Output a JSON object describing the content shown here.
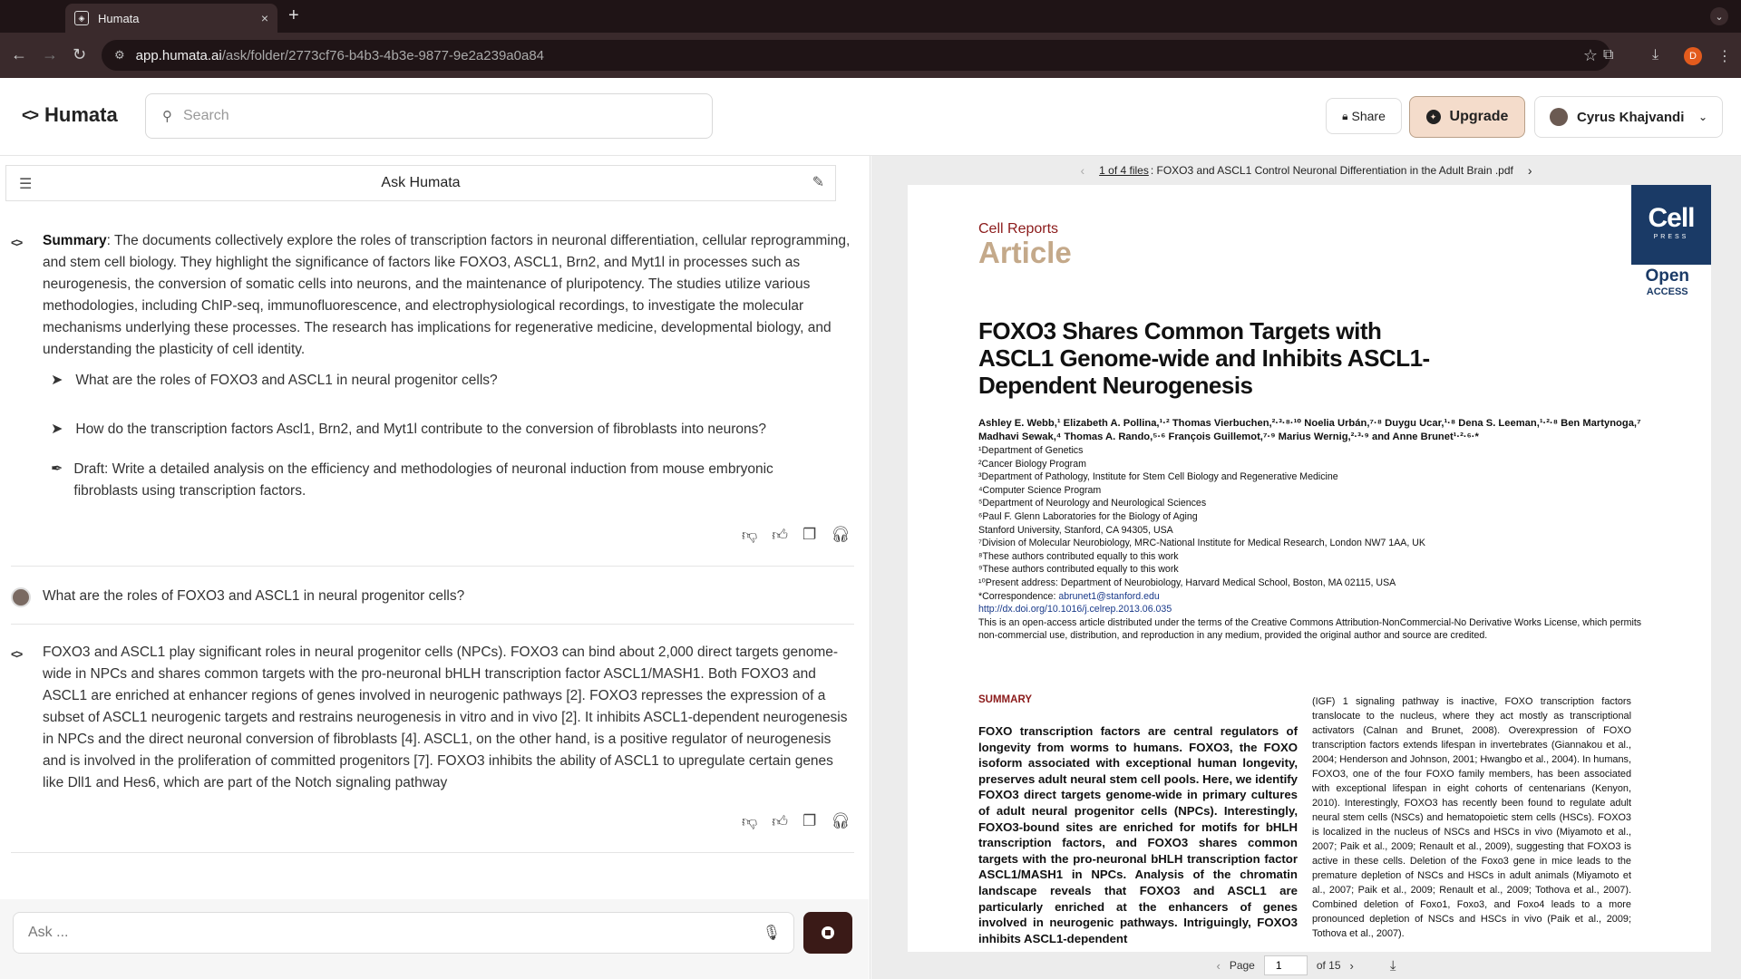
{
  "browser": {
    "tab_title": "Humata",
    "tab_close": "×",
    "new_tab": "+",
    "url_domain": "app.humata.ai",
    "url_path": "/ask/folder/2773cf76-b4b3-4b3e-9877-9e2a239a0a84",
    "profile_initial": "D"
  },
  "header": {
    "logo": "Humata",
    "search_placeholder": "Search",
    "share_label": "Share",
    "upgrade_label": "Upgrade",
    "user_name": "Cyrus Khajvandi"
  },
  "chat": {
    "title": "Ask Humata",
    "summary_label": "Summary",
    "summary_text": ": The documents collectively explore the roles of transcription factors in neuronal differentiation, cellular reprogramming, and stem cell biology. They highlight the significance of factors like FOXO3, ASCL1, Brn2, and Myt1l in processes such as neurogenesis, the conversion of somatic cells into neurons, and the maintenance of pluripotency. The studies utilize various methodologies, including ChIP-seq, immunofluorescence, and electrophysiological recordings, to investigate the molecular mechanisms underlying these processes. The research has implications for regenerative medicine, developmental biology, and understanding the plasticity of cell identity.",
    "suggestions": [
      "What are the roles of FOXO3 and ASCL1 in neural progenitor cells?",
      "How do the transcription factors Ascl1, Brn2, and Myt1l contribute to the conversion of fibroblasts into neurons?"
    ],
    "draft": "Draft: Write a detailed analysis on the efficiency and methodologies of neuronal induction from mouse embryonic fibroblasts using transcription factors.",
    "user_question": "What are the roles of FOXO3 and ASCL1 in neural progenitor cells?",
    "answer": "FOXO3 and ASCL1 play significant roles in neural progenitor cells (NPCs). FOXO3 can bind about 2,000 direct targets genome-wide in NPCs and shares common targets with the pro-neuronal bHLH transcription factor ASCL1/MASH1. Both FOXO3 and ASCL1 are enriched at enhancer regions of genes involved in neurogenic pathways [2]. FOXO3 represses the expression of a subset of ASCL1 neurogenic targets and restrains neurogenesis in vitro and in vivo [2]. It inhibits ASCL1-dependent neurogenesis in NPCs and the direct neuronal conversion of fibroblasts [4]. ASCL1, on the other hand, is a positive regulator of neurogenesis and is involved in the proliferation of committed progenitors [7]. FOXO3 inhibits the ability of ASCL1 to upregulate certain genes like Dll1 and Hes6, which are part of the Notch signaling pathway",
    "ask_placeholder": "Ask ..."
  },
  "viewer": {
    "file_counter": "1 of 4 files",
    "file_name": ": FOXO3 and ASCL1 Control Neuronal Differentiation in the Adult Brain .pdf",
    "page_label": "Page",
    "page_value": "1",
    "page_total": "of 15"
  },
  "pdf": {
    "journal": "Cell Reports",
    "article_type": "Article",
    "logo_big": "Cell",
    "logo_small": "PRESS",
    "open": "Open",
    "access": "ACCESS",
    "title": "FOXO3 Shares Common Targets with ASCL1 Genome-wide and Inhibits ASCL1-Dependent Neurogenesis",
    "authors": "Ashley E. Webb,¹ Elizabeth A. Pollina,¹·² Thomas Vierbuchen,²·³·⁸·¹⁰ Noelia Urbán,⁷·⁸ Duygu Ucar,¹·⁸ Dena S. Leeman,¹·²·⁸ Ben Martynoga,⁷ Madhavi Sewak,⁴ Thomas A. Rando,⁵·⁶ François Guillemot,⁷·⁹ Marius Wernig,²·³·⁹ and Anne Brunet¹·²·⁶·*",
    "affiliations": [
      "¹Department of Genetics",
      "²Cancer Biology Program",
      "³Department of Pathology, Institute for Stem Cell Biology and Regenerative Medicine",
      "⁴Computer Science Program",
      "⁵Department of Neurology and Neurological Sciences",
      "⁶Paul F. Glenn Laboratories for the Biology of Aging",
      "Stanford University, Stanford, CA 94305, USA",
      "⁷Division of Molecular Neurobiology, MRC-National Institute for Medical Research, London NW7 1AA, UK",
      "⁸These authors contributed equally to this work",
      "⁹These authors contributed equally to this work",
      "¹⁰Present address: Department of Neurobiology, Harvard Medical School, Boston, MA 02115, USA"
    ],
    "correspondence_label": "*Correspondence: ",
    "correspondence_email": "abrunet1@stanford.edu",
    "doi": "http://dx.doi.org/10.1016/j.celrep.2013.06.035",
    "license": "This is an open-access article distributed under the terms of the Creative Commons Attribution-NonCommercial-No Derivative Works License, which permits non-commercial use, distribution, and reproduction in any medium, provided the original author and source are credited.",
    "summary_heading": "SUMMARY",
    "summary_body": "FOXO transcription factors are central regulators of longevity from worms to humans. FOXO3, the FOXO isoform associated with exceptional human longevity, preserves adult neural stem cell pools. Here, we identify FOXO3 direct targets genome-wide in primary cultures of adult neural progenitor cells (NPCs). Interestingly, FOXO3-bound sites are enriched for motifs for bHLH transcription factors, and FOXO3 shares common targets with the pro-neuronal bHLH transcription factor ASCL1/MASH1 in NPCs. Analysis of the chromatin landscape reveals that FOXO3 and ASCL1 are particularly enriched at the enhancers of genes involved in neurogenic pathways. Intriguingly, FOXO3 inhibits ASCL1-dependent",
    "col2_text": "(IGF) 1 signaling pathway is inactive, FOXO transcription factors translocate to the nucleus, where they act mostly as transcriptional activators (Calnan and Brunet, 2008). Overexpression of FOXO transcription factors extends lifespan in invertebrates (Giannakou et al., 2004; Henderson and Johnson, 2001; Hwangbo et al., 2004). In humans, FOXO3, one of the four FOXO family members, has been associated with exceptional lifespan in eight cohorts of centenarians (Kenyon, 2010). Interestingly, FOXO3 has recently been found to regulate adult neural stem cells (NSCs) and hematopoietic stem cells (HSCs). FOXO3 is localized in the nucleus of NSCs and HSCs in vivo (Miyamoto et al., 2007; Paik et al., 2009; Renault et al., 2009), suggesting that FOXO3 is active in these cells. Deletion of the Foxo3 gene in mice leads to the premature depletion of NSCs and HSCs in adult animals (Miyamoto et al., 2007; Paik et al., 2009; Renault et al., 2009; Tothova et al., 2007). Combined deletion of Foxo1, Foxo3, and Foxo4 leads to a more pronounced depletion of NSCs and HSCs in vivo (Paik et al., 2009; Tothova et al., 2007)."
  }
}
